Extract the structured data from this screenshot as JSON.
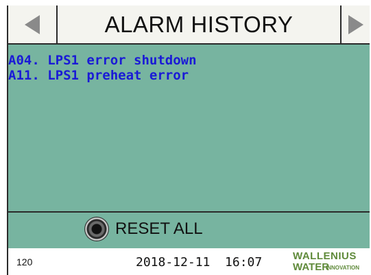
{
  "header": {
    "title": "ALARM HISTORY",
    "prev_icon": "triangle-left-icon",
    "next_icon": "triangle-right-icon"
  },
  "alarms": [
    "A04. LPS1 error shutdown",
    "A11. LPS1 preheat error"
  ],
  "reset": {
    "label": "RESET ALL",
    "icon": "round-button-icon"
  },
  "footer": {
    "code": "120",
    "datetime": "2018-12-11  16:07",
    "logo_line1": "WALLENIUS",
    "logo_line2": "WATER",
    "logo_line3": "INNOVATION"
  },
  "colors": {
    "panel": "#77b4a0",
    "alarm_text": "#1a1ad6",
    "logo": "#5f8a3a"
  }
}
